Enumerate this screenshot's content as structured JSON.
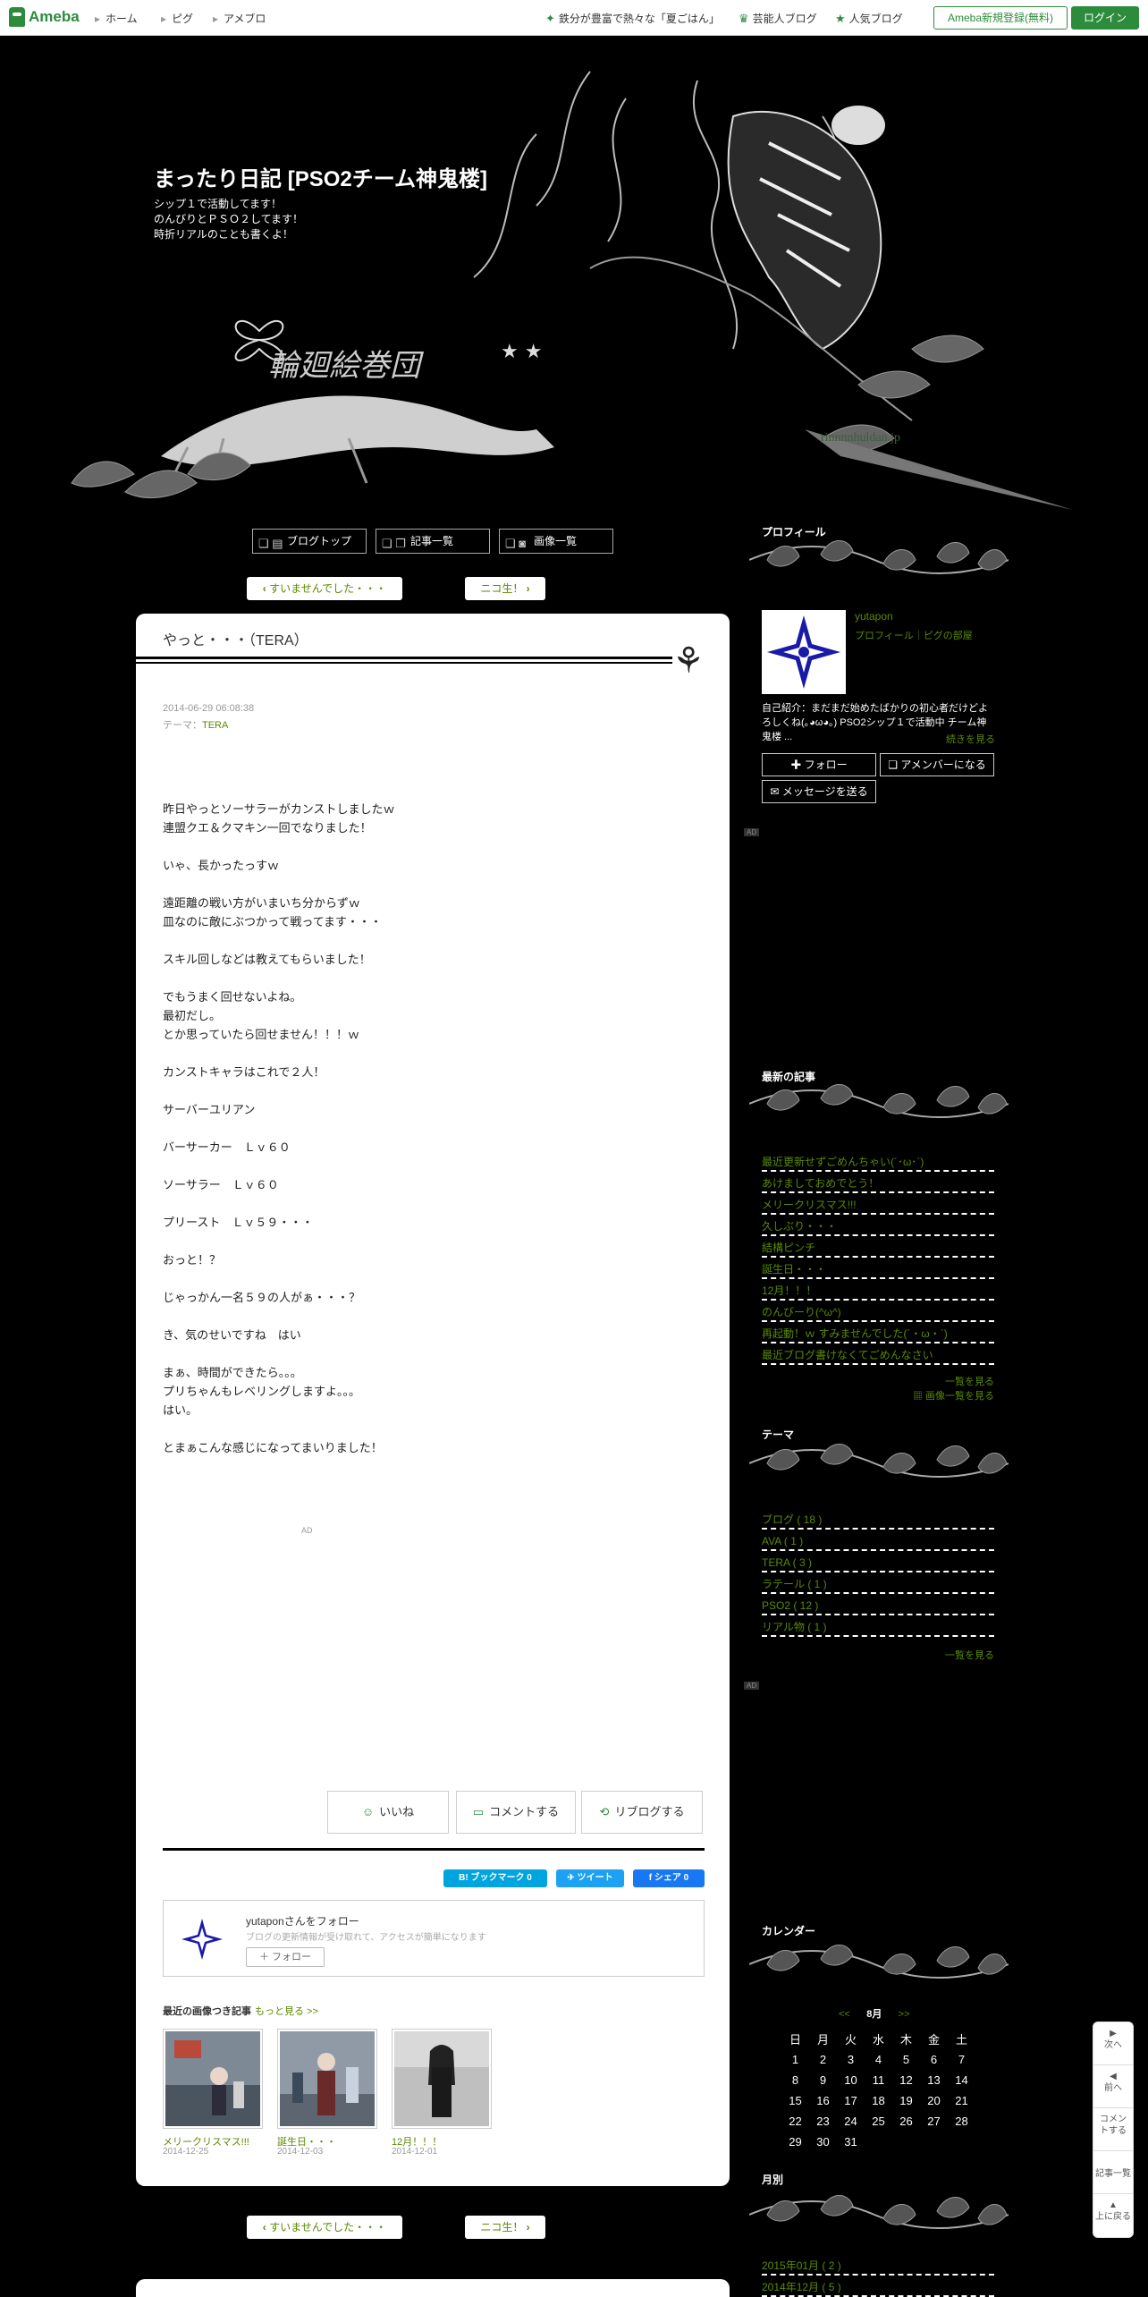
{
  "topbar": {
    "logo": "Ameba",
    "nav": [
      "ホーム",
      "ピグ",
      "アメブロ"
    ],
    "promo": "鉄分が豊富で熱々な「夏ごはん」",
    "celeb_blog": "芸能人ブログ",
    "popular_blog": "人気ブログ",
    "signup": "Ameba新規登録(無料)",
    "login": "ログイン"
  },
  "header": {
    "title": "まったり日記 [PSO2チーム神鬼楼]",
    "description": "シップ１で活動してます！\nのんびりとＰＳＯ２してます！\n時折リアルのことも書くよ！",
    "watermark": "rinnnnhuldan.jp"
  },
  "blognav": {
    "top": "ブログトップ",
    "list": "記事一覧",
    "images": "画像一覧"
  },
  "pager": {
    "prev": "すいませんでした・・・",
    "next": "ニコ生！"
  },
  "article": {
    "title": "やっと・・・（TERA）",
    "date": "2014-06-29 06:08:38",
    "theme_label": "テーマ：",
    "theme": "TERA",
    "body": "昨日やっとソーサラーがカンストしましたｗ\n連盟クエ＆クマキン一回でなりました！\n\nいゃ、長かったっすｗ\n\n遠距離の戦い方がいまいち分からずｗ\n皿なのに敵にぶつかって戦ってます・・・\n\nスキル回しなどは教えてもらいました！\n\nでもうまく回せないよね。\n最初だし。\nとか思っていたら回せません！！！ｗ\n\nカンストキャラはこれで２人！\n\nサーバーユリアン\n\nバーサーカー　Ｌｖ６０\n\nソーサラー　Ｌｖ６０\n\nプリースト　Ｌｖ５９・・・\n\nおっと！？\n\nじゃっかん一名５９の人がぁ・・・？\n\nき、気のせいですね　はい\n\nまぁ、時間ができたら。。。\nプリちゃんもレベリングしますよ。。。\nはい。\n\nとまぁこんな感じになってまいりました！",
    "ad_label": "AD",
    "like": "いいね",
    "comment": "コメントする",
    "reblog": "リブログする",
    "hatena": "B! ブックマーク 0",
    "tweet": "ツイート",
    "fb_share": "シェア 0",
    "follow_name": "yutaponさんをフォロー",
    "follow_desc": "ブログの更新情報が受け取れて、アクセスが簡単になります",
    "follow_btn": "＋ フォロー",
    "recent_head": "最近の画像つき記事",
    "recent_more": "もっと見る >>",
    "thumbs": [
      {
        "title": "メリークリスマス!!!",
        "date": "2014-12-25"
      },
      {
        "title": "誕生日・・・",
        "date": "2014-12-03"
      },
      {
        "title": "12月！！！",
        "date": "2014-12-01"
      }
    ]
  },
  "sidebar": {
    "profile_head": "プロフィール",
    "profile_name": "yutapon",
    "profile_links": "プロフィール｜ピグの部屋",
    "profile_intro": "自己紹介：まだまだ始めたばかりの初心者だけどよろしくね(｡◕ω◕｡) PSO2シップ１で活動中 チーム神鬼楼 ...",
    "profile_more": "続きを見る",
    "follow": "フォロー",
    "member": "アメンバーになる",
    "message": "メッセージを送る",
    "ad_tag": "AD",
    "recent_head": "最新の記事",
    "recent": [
      "最近更新せずごめんちゃい(´･ω･`)",
      "あけましておめでとう！",
      "メリークリスマス!!!",
      "久しぶり・・・",
      "結構ピンチ",
      "誕生日・・・",
      "12月！！！",
      "のんびーり(^ω^)",
      "再起動！ｗ すみませんでした(´・ω・`)",
      "最近ブログ書けなくてごめんなさい"
    ],
    "recent_more_list": "一覧を見る",
    "recent_more_images": "画像一覧を見る",
    "theme_head": "テーマ",
    "themes": [
      "ブログ ( 18 )",
      "AVA ( 1 )",
      "TERA ( 3 )",
      "ラテール ( 1 )",
      "PSO2 ( 12 )",
      "リアル物 ( 1 )"
    ],
    "theme_more": "一覧を見る",
    "calendar_head": "カレンダー",
    "calendar_prev": "<<",
    "calendar_month": "8月",
    "calendar_next": ">>",
    "weekdays": [
      "日",
      "月",
      "火",
      "水",
      "木",
      "金",
      "土"
    ],
    "weeks": [
      [
        "1",
        "2",
        "3",
        "4",
        "5",
        "6",
        "7"
      ],
      [
        "8",
        "9",
        "10",
        "11",
        "12",
        "13",
        "14"
      ],
      [
        "15",
        "16",
        "17",
        "18",
        "19",
        "20",
        "21"
      ],
      [
        "22",
        "23",
        "24",
        "25",
        "26",
        "27",
        "28"
      ],
      [
        "29",
        "30",
        "31",
        "",
        "",
        "",
        ""
      ]
    ],
    "monthly_head": "月別",
    "months": [
      "2015年01月 ( 2 )",
      "2014年12月 ( 5 )"
    ]
  },
  "float_pager": [
    "次へ",
    "前へ",
    "コメントする",
    "記事一覧",
    "上に戻る"
  ],
  "colors": {
    "accent": "#5a8a00",
    "ameba_green": "#2d8c3c",
    "background": "#000000"
  }
}
